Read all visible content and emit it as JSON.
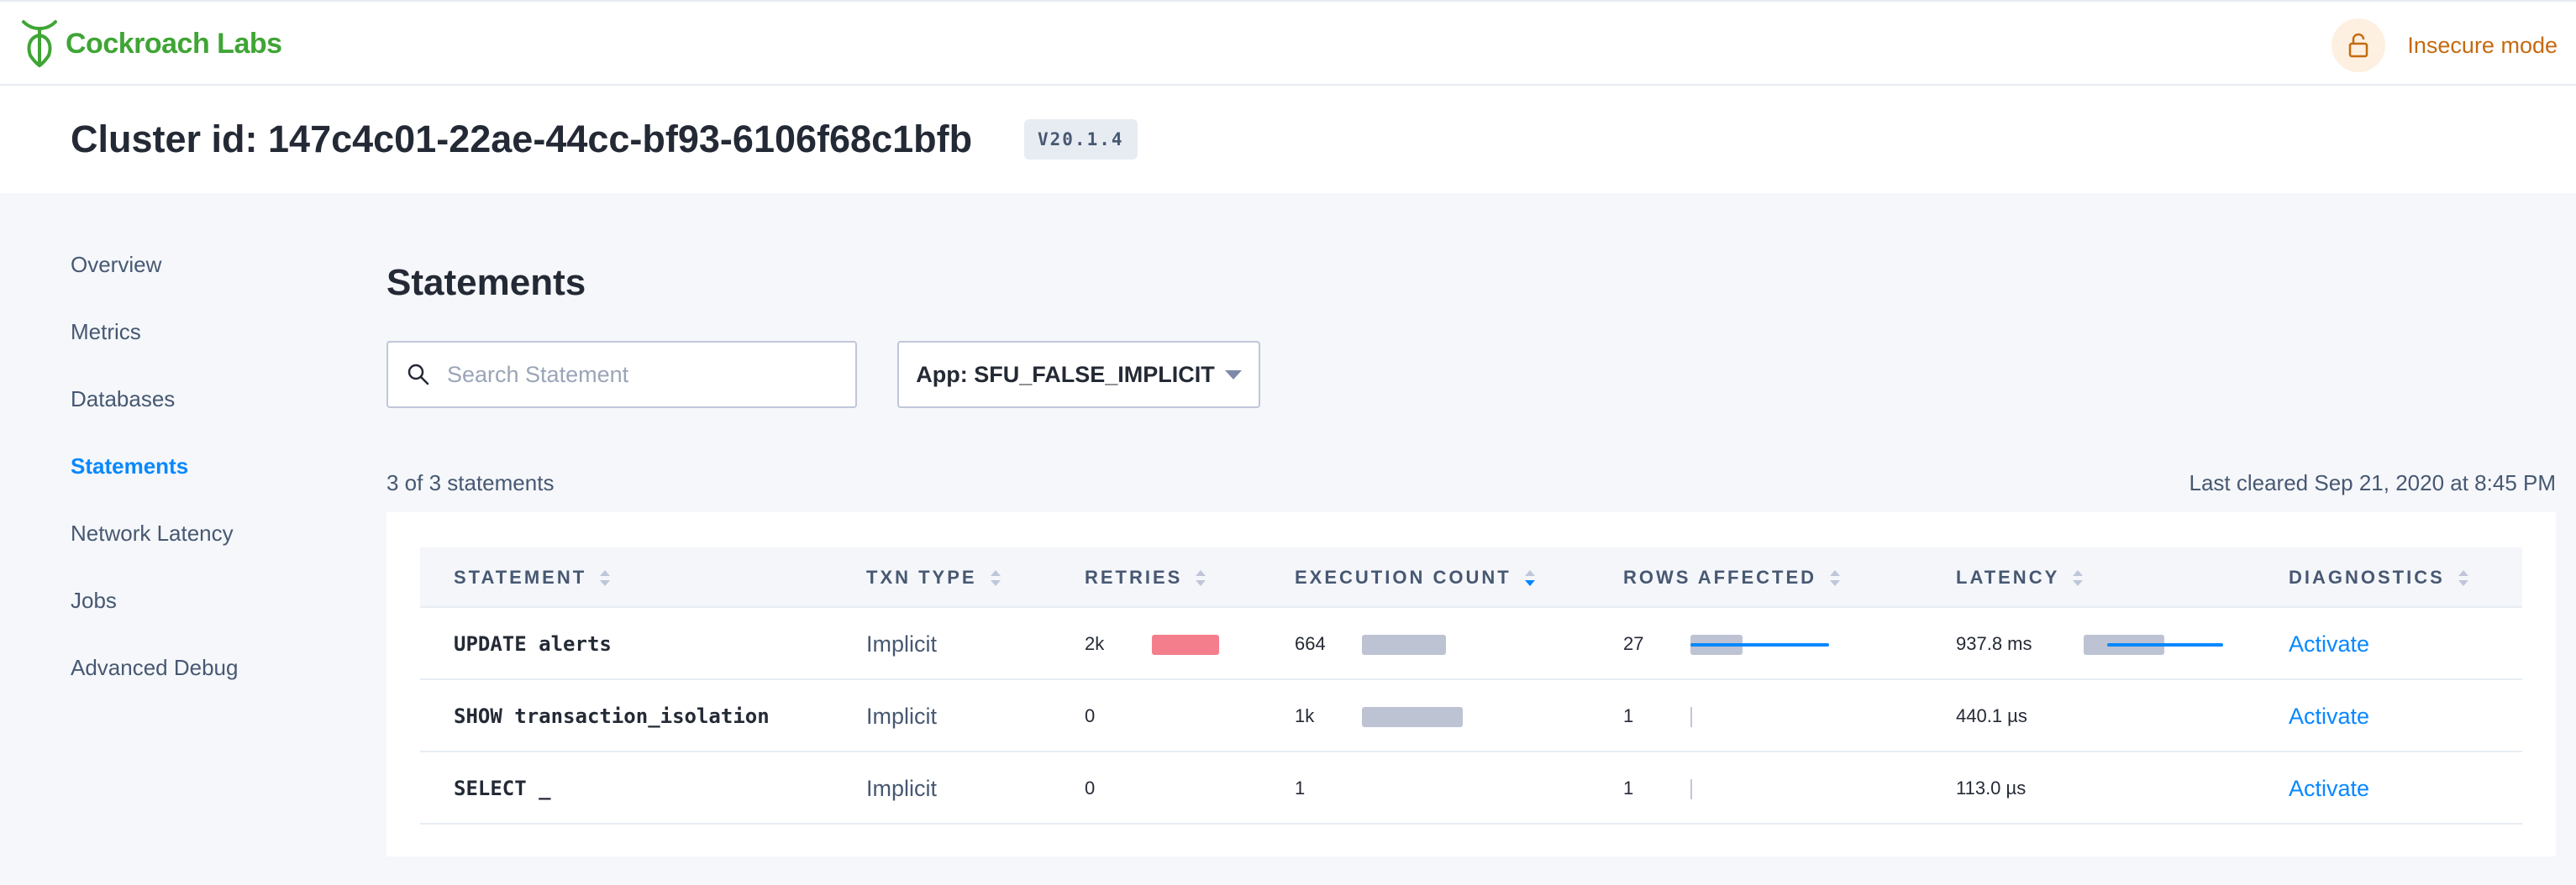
{
  "header": {
    "brand": "Cockroach Labs",
    "security_status": "Insecure mode"
  },
  "cluster": {
    "title": "Cluster id: 147c4c01-22ae-44cc-bf93-6106f68c1bfb",
    "version": "V20.1.4"
  },
  "sidebar": {
    "items": [
      {
        "label": "Overview",
        "active": false
      },
      {
        "label": "Metrics",
        "active": false
      },
      {
        "label": "Databases",
        "active": false
      },
      {
        "label": "Statements",
        "active": true
      },
      {
        "label": "Network Latency",
        "active": false
      },
      {
        "label": "Jobs",
        "active": false
      },
      {
        "label": "Advanced Debug",
        "active": false
      }
    ]
  },
  "page": {
    "title": "Statements",
    "search_placeholder": "Search Statement",
    "search_value": "",
    "app_filter": "App: SFU_FALSE_IMPLICIT",
    "count_text": "3 of 3 statements",
    "last_cleared": "Last cleared Sep 21, 2020 at 8:45 PM"
  },
  "table": {
    "columns": [
      "STATEMENT",
      "TXN TYPE",
      "RETRIES",
      "EXECUTION COUNT",
      "ROWS AFFECTED",
      "LATENCY",
      "DIAGNOSTICS"
    ],
    "sorted_column": "EXECUTION COUNT",
    "rows": [
      {
        "statement": "UPDATE alerts",
        "txn_type": "Implicit",
        "retries": "2k",
        "execution_count": "664",
        "rows_affected": "27",
        "latency": "937.8 ms",
        "diagnostics": "Activate"
      },
      {
        "statement": "SHOW transaction_isolation",
        "txn_type": "Implicit",
        "retries": "0",
        "execution_count": "1k",
        "rows_affected": "1",
        "latency": "440.1 µs",
        "diagnostics": "Activate"
      },
      {
        "statement": "SELECT _",
        "txn_type": "Implicit",
        "retries": "0",
        "execution_count": "1",
        "rows_affected": "1",
        "latency": "113.0 µs",
        "diagnostics": "Activate"
      }
    ]
  },
  "colors": {
    "brand_green": "#3fa535",
    "accent_blue": "#0788ff",
    "warning_orange": "#c46a10",
    "retries_bar": "#f57e8c",
    "neutral_bar": "#bdc3d3"
  }
}
